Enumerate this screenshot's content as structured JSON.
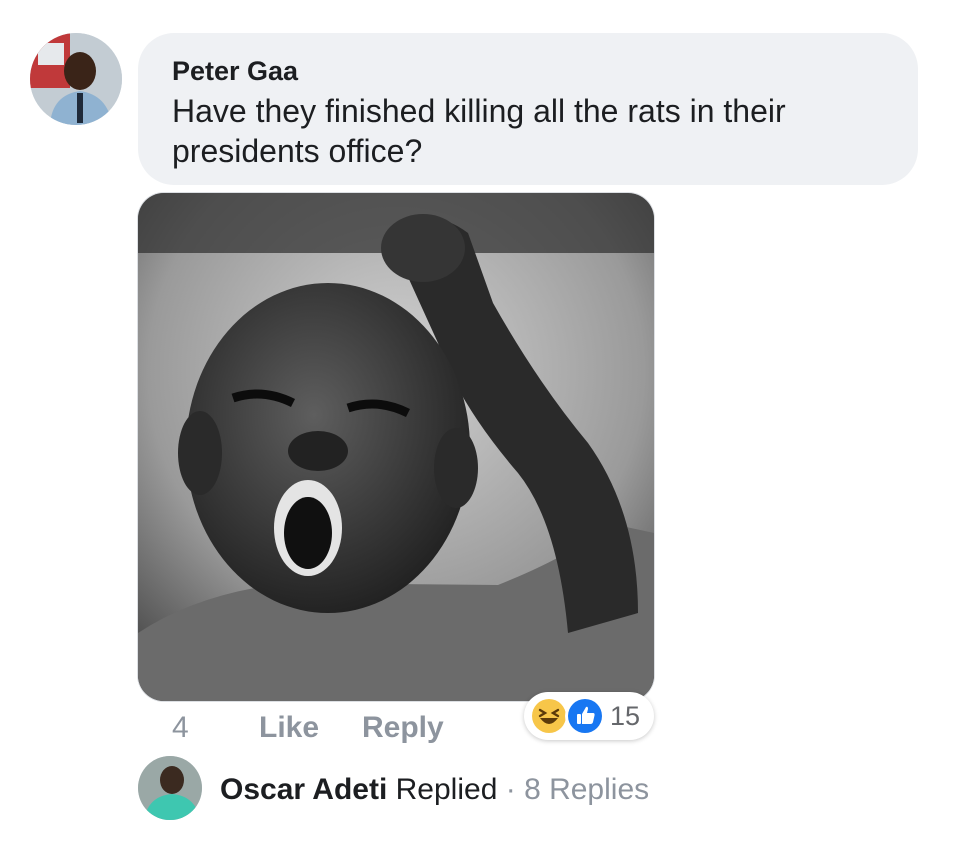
{
  "comment": {
    "author": "Peter Gaa",
    "text_line1": "Have they finished killing all the rats in their",
    "text_line2": "presidents office?",
    "time": "4 h",
    "like_label": "Like",
    "reply_label": "Reply",
    "reaction_count": "15",
    "reaction_icons": [
      "haha-icon",
      "like-thumb-icon"
    ],
    "reaction_colors": {
      "haha": "#f7c649",
      "like": "#1877f2"
    }
  },
  "replies": {
    "author": "Oscar Adeti",
    "action": "Replied",
    "separator": "·",
    "count_label": "8 Replies"
  }
}
